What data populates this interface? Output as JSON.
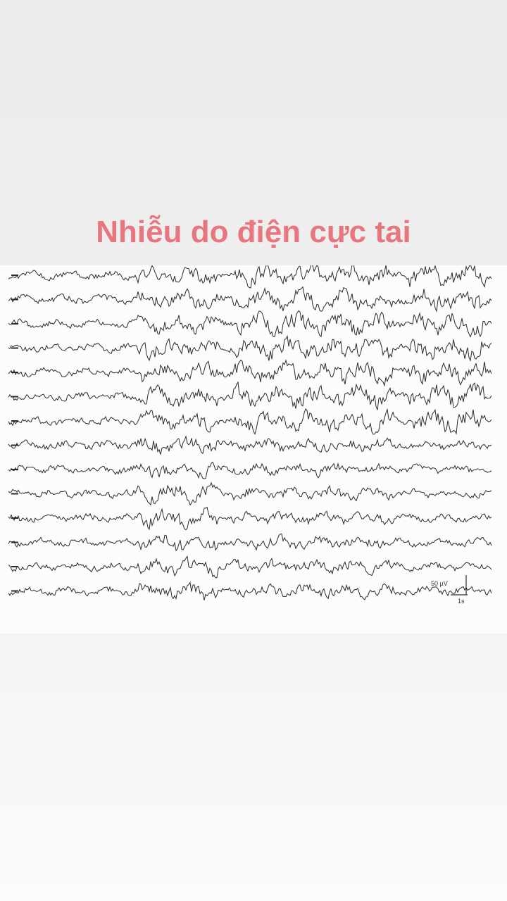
{
  "slide": {
    "title": "Nhiễu do điện cực tai",
    "title_color": "#e8767f"
  },
  "eeg_figure": {
    "channel_count": 14,
    "scale_amplitude_label": "50 µV",
    "scale_time_label": "1s",
    "trace_color": "#2a2a2a"
  }
}
